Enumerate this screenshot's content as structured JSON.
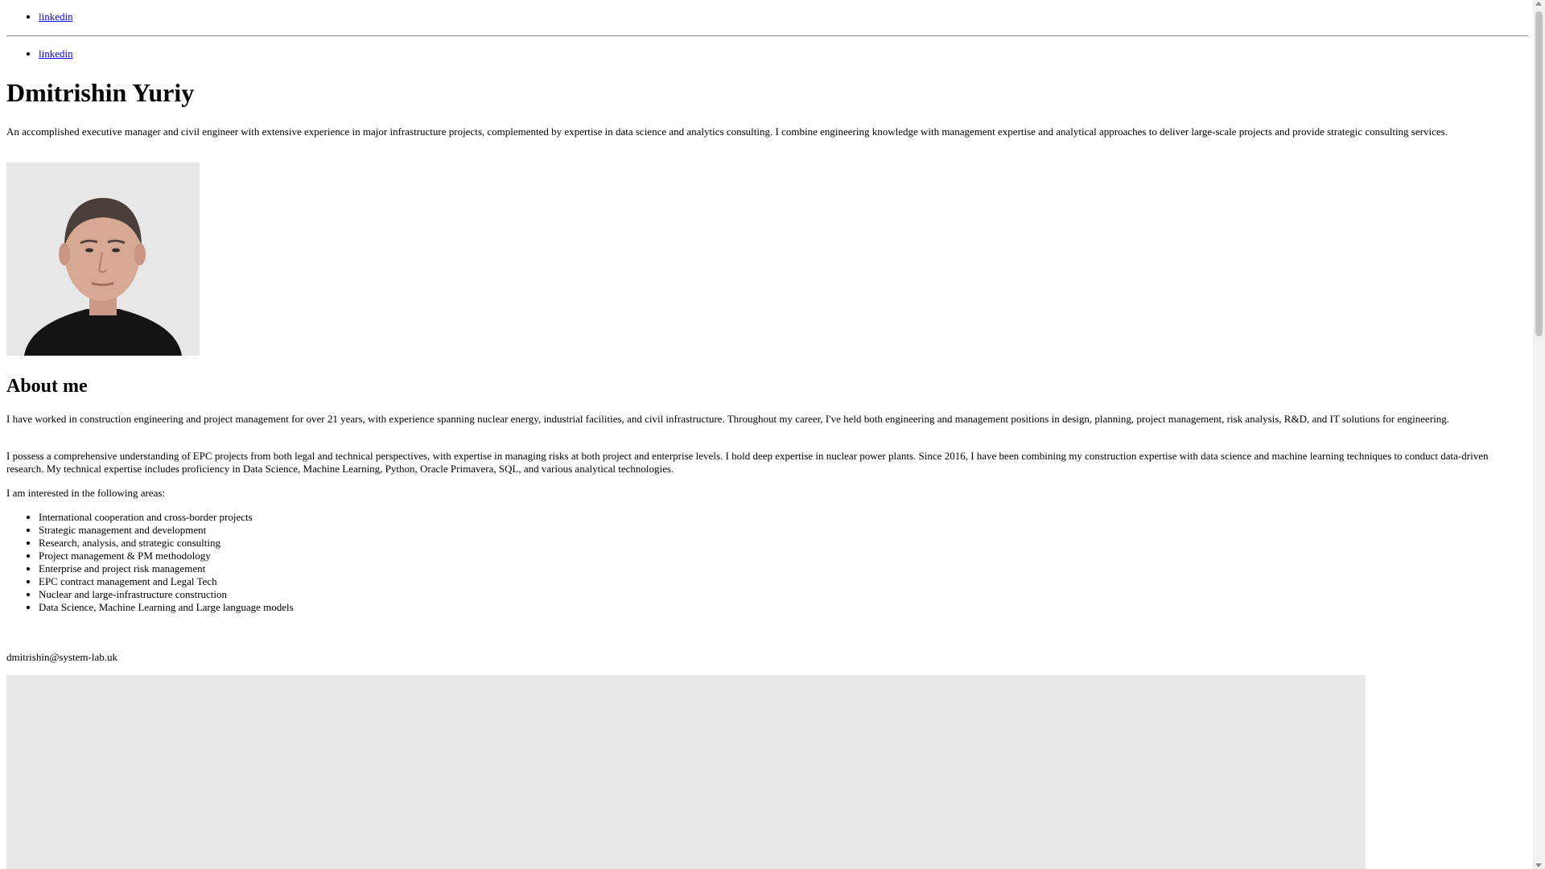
{
  "nav": {
    "top_link": "linkedin",
    "bottom_link": "linkedin"
  },
  "profile": {
    "name": "Dmitrishin Yuriy",
    "intro": "An accomplished executive manager and civil engineer with extensive experience in major infrastructure projects, complemented by expertise in data science and analytics consulting. I combine engineering knowledge with management expertise and analytical approaches to deliver large-scale projects and provide strategic consulting services."
  },
  "about": {
    "heading": "About me",
    "paragraph1": "I have worked in construction engineering and project management for over 21 years, with experience spanning nuclear energy, industrial facilities, and civil infrastructure. Throughout my career, I've held both engineering and management positions in design, planning, project management, risk analysis, R&D, and IT solutions for engineering.",
    "paragraph2": "I possess a comprehensive understanding of EPC projects from both legal and technical perspectives, with expertise in managing risks at both project and enterprise levels. I hold deep expertise in nuclear power plants. Since 2016, I have been combining my construction expertise with data science and machine learning techniques to conduct data-driven research. My technical expertise includes proficiency in Data Science, Machine Learning, Python, Oracle Primavera, SQL, and various analytical technologies.",
    "interests_intro": "I am interested in the following areas:",
    "interests": [
      "International cooperation and cross-border projects",
      "Strategic management and development",
      "Research, analysis, and strategic consulting",
      "Project management & PM methodology",
      "Enterprise and project risk management",
      "EPC contract management and Legal Tech",
      "Nuclear and large-infrastructure construction",
      "Data Science, Machine Learning and Large language models"
    ]
  },
  "contact": {
    "email": "dmitrishin@system-lab.uk"
  },
  "colors": {
    "link": "#0000ee",
    "placeholder_bg": "#e6e6e6",
    "shirt": "#141414"
  }
}
